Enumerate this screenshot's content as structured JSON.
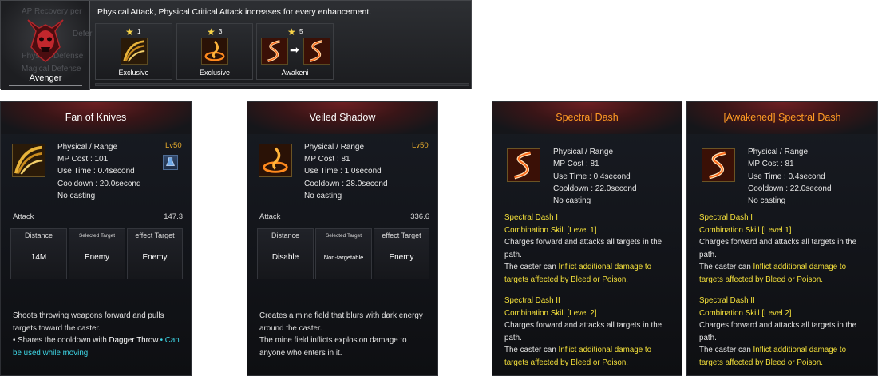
{
  "class_panel": {
    "name": "Avenger",
    "ghost_lines": [
      "AP Recovery per",
      "Defer",
      "Physical Defense",
      "Magical Defense",
      "160"
    ]
  },
  "enhancement": {
    "description": "Physical Attack, Physical Critical Attack increases for every enhancement.",
    "cards": [
      {
        "star": "★",
        "level": "1",
        "label": "Exclusive"
      },
      {
        "star": "★",
        "level": "3",
        "label": "Exclusive"
      },
      {
        "star": "★",
        "level": "5",
        "label": "Awakeni",
        "arrow": "➡"
      }
    ]
  },
  "tooltips": [
    {
      "title": "Fan of Knives",
      "level": "Lv50",
      "info": [
        "Physical / Range",
        "MP Cost : 101",
        "Use Time : 0.4second",
        "Cooldown : 20.0second",
        "No casting"
      ],
      "stat_label": "Attack",
      "stat_value": "147.3",
      "cells": [
        {
          "head": "Distance",
          "value": "14M"
        },
        {
          "head": "Selected Target",
          "value": "Enemy"
        },
        {
          "head": "effect Target",
          "value": "Enemy"
        }
      ],
      "desc_1": "Shoots throwing weapons forward and pulls",
      "desc_2": "targets toward the caster.",
      "desc_3a": "• Shares the cooldown with ",
      "desc_3b": "Dagger Throw",
      "desc_3c": ".• Can",
      "desc_4": "be used while moving"
    },
    {
      "title": "Veiled Shadow",
      "level": "Lv50",
      "info": [
        "Physical / Range",
        "MP Cost : 81",
        "Use Time : 1.0second",
        "Cooldown : 28.0second",
        "No casting"
      ],
      "stat_label": "Attack",
      "stat_value": "336.6",
      "cells": [
        {
          "head": "Distance",
          "value": "Disable"
        },
        {
          "head": "Selected Target",
          "value": "Non-targetable"
        },
        {
          "head": "effect Target",
          "value": "Enemy"
        }
      ],
      "desc_1": "Creates a mine field that blurs with dark energy",
      "desc_2": "around the caster.",
      "desc_3": "The mine field inflicts explosion damage to",
      "desc_4": "anyone who enters in it."
    },
    {
      "title": "Spectral Dash",
      "info": [
        "Physical / Range",
        "MP Cost : 81",
        "Use Time : 0.4second",
        "Cooldown : 22.0second",
        "No casting"
      ],
      "sections": [
        {
          "name": "Spectral Dash I",
          "combo": "Combination Skill [Level 1]",
          "line1": "Charges forward and attacks all targets in the",
          "line2": "path.",
          "pre": "The caster can ",
          "hl": "Inflict additional damage to",
          "line4": "targets affected by Bleed or Poison."
        },
        {
          "name": "Spectral Dash II",
          "combo": "Combination Skill [Level 2]",
          "line1": "Charges forward and attacks all targets in the",
          "line2": "path.",
          "pre": "The caster can ",
          "hl": "Inflict additional damage to",
          "line4": "targets affected by Bleed or Poison."
        }
      ]
    },
    {
      "title": "[Awakened] Spectral Dash",
      "info": [
        "Physical / Range",
        "MP Cost : 81",
        "Use Time : 0.4second",
        "Cooldown : 22.0second",
        "No casting"
      ],
      "sections": [
        {
          "name": "Spectral Dash I",
          "combo": "Combination Skill [Level 1]",
          "line1": "Charges forward and attacks all targets in the",
          "line2": "path.",
          "pre": "The caster can ",
          "hl": "Inflict additional damage to",
          "line4": "targets affected by Bleed or Poison."
        },
        {
          "name": "Spectral Dash II",
          "combo": "Combination Skill [Level 2]",
          "line1": "Charges forward and attacks all targets in the",
          "line2": "path.",
          "pre": "The caster can ",
          "hl": "Inflict additional damage to",
          "line4": "targets affected by Bleed or Poison."
        }
      ]
    }
  ],
  "colors": {
    "title_red_glow": "#6d1f22",
    "title_orange": "#ff9a24",
    "section_yellow": "#f5e13a",
    "level_gold": "#e3a92c",
    "cyan_note": "#3ed6e6"
  },
  "icons": {
    "class_emblem": "demon-skull-icon",
    "fan_of_knives": "blade-fan-icon",
    "veiled_shadow": "fire-ring-icon",
    "spectral_dash": "flame-slash-icon",
    "potion": "potion-icon"
  }
}
